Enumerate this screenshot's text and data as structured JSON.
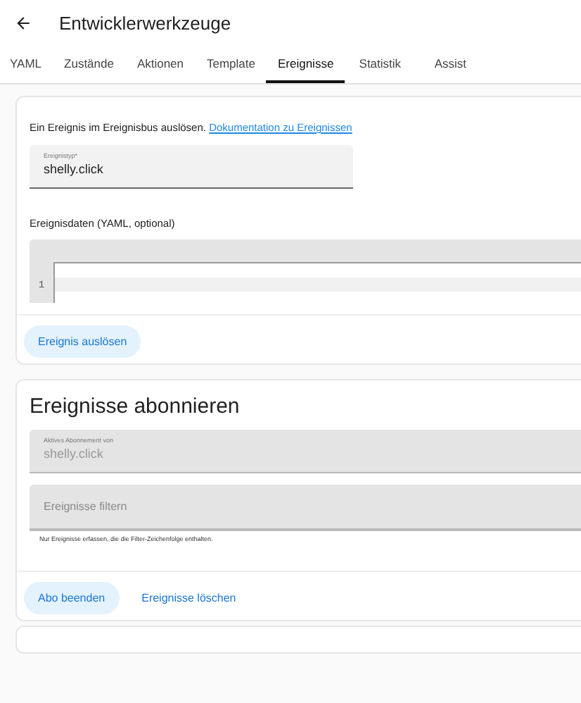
{
  "header": {
    "title": "Entwicklerwerkzeuge"
  },
  "tabs": [
    {
      "label": "YAML",
      "selected": false
    },
    {
      "label": "Zustände",
      "selected": false
    },
    {
      "label": "Aktionen",
      "selected": false
    },
    {
      "label": "Template",
      "selected": false
    },
    {
      "label": "Ereignisse",
      "selected": true
    },
    {
      "label": "Statistik",
      "selected": false
    },
    {
      "label": "Assist",
      "selected": false
    }
  ],
  "fire_event": {
    "intro": "Ein Ereignis im Ereignisbus auslösen.",
    "doc_link": "Dokumentation zu Ereignissen",
    "event_type": {
      "label": "Ereignistyp*",
      "value": "shelly.click"
    },
    "data_label": "Ereignisdaten (YAML, optional)",
    "editor": {
      "line_numbers": [
        "1"
      ]
    },
    "button": "Ereignis auslösen"
  },
  "subscribe": {
    "title": "Ereignisse abonnieren",
    "active": {
      "label": "Aktives Abonnement von",
      "value": "shelly.click",
      "disabled": true
    },
    "filter": {
      "placeholder": "Ereignisse filtern",
      "disabled": true
    },
    "helper": "Nur Ereignisse erfassen, die die Filter-Zeichenfolge enthalten.",
    "buttons": [
      {
        "label": "Abo beenden",
        "kind": "tonal"
      },
      {
        "label": "Ereignisse löschen",
        "kind": "text"
      }
    ]
  }
}
